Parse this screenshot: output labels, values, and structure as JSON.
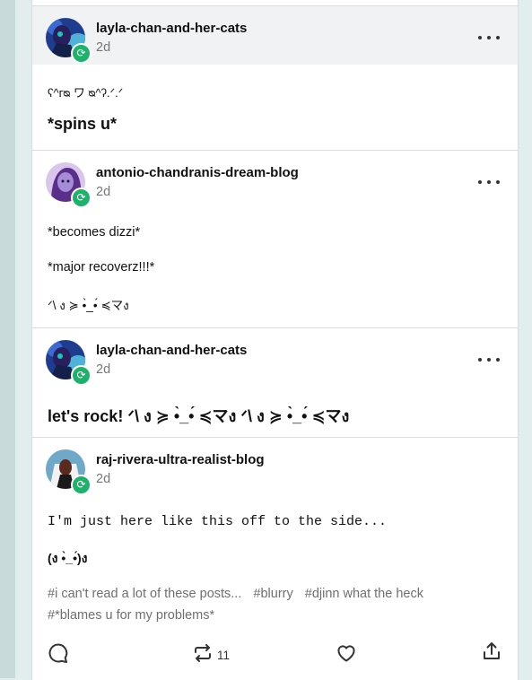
{
  "posts": [
    {
      "username": "layla-chan-and-her-cats",
      "time": "2d",
      "lines": [
        "ʕ^ᴦᴓ ワ ᴓ^ʔ.ᐟ.ᐟ",
        "*spins u*"
      ]
    },
    {
      "username": "antonio-chandranis-dream-blog",
      "time": "2d",
      "lines": [
        "*becomes dizzi*",
        "*major recoverz!!!*",
        "ᐟ\\ ง ≽ •̀_•́ ≼マง"
      ]
    },
    {
      "username": "layla-chan-and-her-cats",
      "time": "2d",
      "lines": [
        "let's rock! ᐟ\\ ง ≽ •̀_•́ ≼マง ᐟ\\ ง ≽ •̀_•́ ≼マง"
      ]
    },
    {
      "username": "raj-rivera-ultra-realist-blog",
      "time": "2d",
      "lines": [
        "I'm just here like this off to the side...",
        "(ง •̀_•́)ง"
      ]
    }
  ],
  "tags": [
    "#i can't read a lot of these posts...",
    "#blurry",
    "#djinn what the heck",
    "#*blames u for my problems*"
  ],
  "actions": {
    "reblog_count": "11"
  },
  "icons": {
    "badge": "reblog-badge-icon",
    "more": "more-icon",
    "reply": "reply-icon",
    "reblog": "reblog-icon",
    "like": "like-icon",
    "share": "share-icon"
  },
  "colors": {
    "badge_green": "#1bb36a",
    "header_grey": "#f1f2f3",
    "tag_grey": "#6f6f6f",
    "background": "#e2eeee"
  }
}
